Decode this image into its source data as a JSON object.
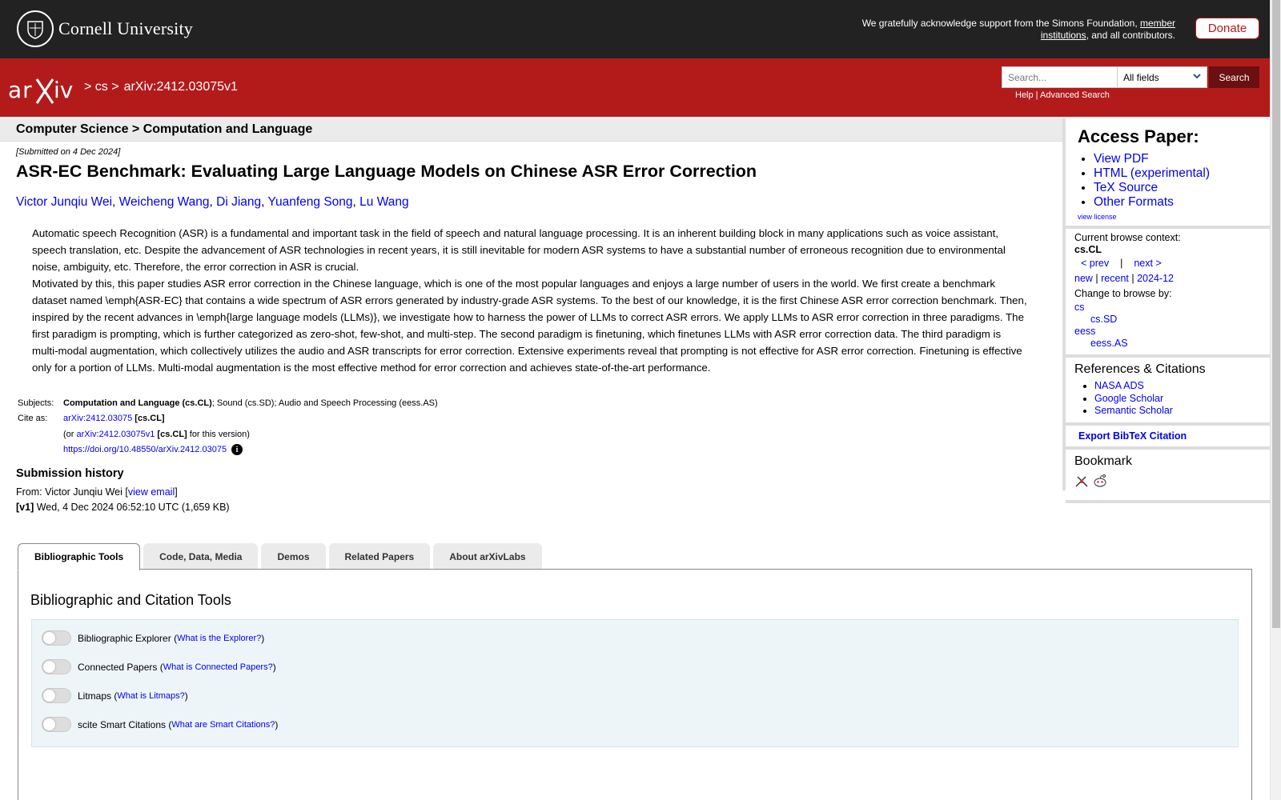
{
  "header": {
    "brand": "Cornell University",
    "support_prefix": "We gratefully acknowledge support from the Simons Foundation, ",
    "support_link": "member institutions",
    "support_suffix": ", and all contributors.",
    "donate": "Donate"
  },
  "arxiv_bar": {
    "breadcrumb": [
      "> cs >",
      "arXiv:2412.03075v1"
    ],
    "search_placeholder": "Search...",
    "search_field": "All fields",
    "search_button": "Search",
    "help": "Help",
    "sep": " | ",
    "advanced": "Advanced Search"
  },
  "subheader": "Computer Science > Computation and Language",
  "submitted": "[Submitted on 4 Dec 2024]",
  "title": "ASR-EC Benchmark: Evaluating Large Language Models on Chinese ASR Error Correction",
  "authors": [
    "Victor Junqiu Wei",
    "Weicheng Wang",
    "Di Jiang",
    "Yuanfeng Song",
    "Lu Wang"
  ],
  "abstract": [
    "Automatic speech Recognition (ASR) is a fundamental and important task in the field of speech and natural language processing. It is an inherent building block in many applications such as voice assistant, speech translation, etc. Despite the advancement of ASR technologies in recent years, it is still inevitable for modern ASR systems to have a substantial number of erroneous recognition due to environmental noise, ambiguity, etc. Therefore, the error correction in ASR is crucial.",
    "Motivated by this, this paper studies ASR error correction in the Chinese language, which is one of the most popular languages and enjoys a large number of users in the world. We first create a benchmark dataset named \\emph{ASR-EC} that contains a wide spectrum of ASR errors generated by industry-grade ASR systems. To the best of our knowledge, it is the first Chinese ASR error correction benchmark. Then, inspired by the recent advances in \\emph{large language models (LLMs)}, we investigate how to harness the power of LLMs to correct ASR errors. We apply LLMs to ASR error correction in three paradigms. The first paradigm is prompting, which is further categorized as zero-shot, few-shot, and multi-step. The second paradigm is finetuning, which finetunes LLMs with ASR error correction data. The third paradigm is multi-modal augmentation, which collectively utilizes the audio and ASR transcripts for error correction. Extensive experiments reveal that prompting is not effective for ASR error correction. Finetuning is effective only for a portion of LLMs. Multi-modal augmentation is the most effective method for error correction and achieves state-of-the-art performance."
  ],
  "meta": {
    "subjects_label": "Subjects:",
    "subjects_primary": "Computation and Language (cs.CL)",
    "subjects_rest": "; Sound (cs.SD); Audio and Speech Processing (eess.AS)",
    "cite_label": "Cite as:",
    "cite_id": "arXiv:2412.03075",
    "cite_cat": " [cs.CL]",
    "cite_or": "(or ",
    "cite_version": "arXiv:2412.03075v1",
    "cite_version_cat": " [cs.CL]",
    "cite_version_suffix": " for this version)",
    "doi": "https://doi.org/10.48550/arXiv.2412.03075",
    "info_icon": "i"
  },
  "history": {
    "title": "Submission history",
    "from_prefix": "From: Victor Junqiu Wei [",
    "view_email": "view email",
    "from_suffix": "]",
    "v1_tag": "[v1]",
    "v1_text": " Wed, 4 Dec 2024 06:52:10 UTC (1,659 KB)"
  },
  "tabs": [
    "Bibliographic Tools",
    "Code, Data, Media",
    "Demos",
    "Related Papers",
    "About arXivLabs"
  ],
  "panel": {
    "title": "Bibliographic and Citation Tools",
    "tools": [
      {
        "name": "Bibliographic Explorer",
        "link": "What is the Explorer?"
      },
      {
        "name": "Connected Papers",
        "link": "What is Connected Papers?"
      },
      {
        "name": "Litmaps",
        "link": "What is Litmaps?"
      },
      {
        "name": "scite Smart Citations",
        "link": "What are Smart Citations?"
      }
    ]
  },
  "sidebar": {
    "access_title": "Access Paper:",
    "access_links": [
      "View PDF",
      "HTML (experimental)",
      "TeX Source",
      "Other Formats"
    ],
    "view_license": "view license",
    "context_label": "Current browse context:",
    "context": "cs.CL",
    "prev": "< prev",
    "pipe": "|",
    "next": "next >",
    "new": "new",
    "recent": "recent",
    "month": "2024-12",
    "change_label": "Change to browse by:",
    "browse_cs": "cs",
    "browse_cs_sd": "cs.SD",
    "browse_eess": "eess",
    "browse_eess_as": "eess.AS",
    "refs_title": "References & Citations",
    "refs": [
      "NASA ADS",
      "Google Scholar",
      "Semantic Scholar"
    ],
    "export": "Export BibTeX Citation",
    "bookmark": "Bookmark"
  },
  "colors": {
    "arxiv_red": "#b31b1b",
    "top_bar": "#222222",
    "link": "#0000ee"
  }
}
